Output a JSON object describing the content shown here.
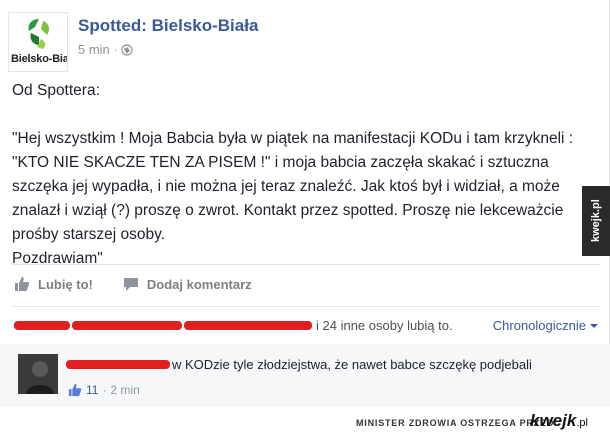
{
  "post": {
    "page_name": "Spotted: Bielsko-Biała",
    "avatar_text": "Bielsko-Biał",
    "time": "5 min",
    "meta_separator": "·",
    "intro": "Od Spottera:",
    "body": "\"Hej wszystkim ! Moja Babcia była w piątek na manifestacji KODu i tam krzykneli : \"KTO NIE SKACZE TEN ZA PISEM !\" i moja babcia zaczęła skakać i sztuczna szczęka jej wypadła, i nie można jej teraz znaleźć. Jak ktoś był i widział, a może znalazł i wziął (?) proszę o zwrot. Kontakt przez spotted. Proszę nie lekceważcie prośby starszej osoby.\nPozdrawiam\""
  },
  "actions": {
    "like_label": "Lubię to!",
    "comment_label": "Dodaj komentarz"
  },
  "likes": {
    "summary": "i 24 inne osoby lubią to.",
    "order_label": "Chronologicznie"
  },
  "comment": {
    "text": "w KODzie tyle złodziejstwa, że nawet babce szczękę podjebali",
    "like_count": "11",
    "separator": "·",
    "time": "2 min"
  },
  "watermark": {
    "warning": "MINISTER ZDROWIA OSTRZEGA PRZED",
    "logo": "kwejk",
    "logo_suffix": ".pl",
    "side_tab": "kwejk.pl"
  },
  "colors": {
    "link": "#3b5998",
    "muted": "#90949c",
    "redaction": "#e02020"
  }
}
